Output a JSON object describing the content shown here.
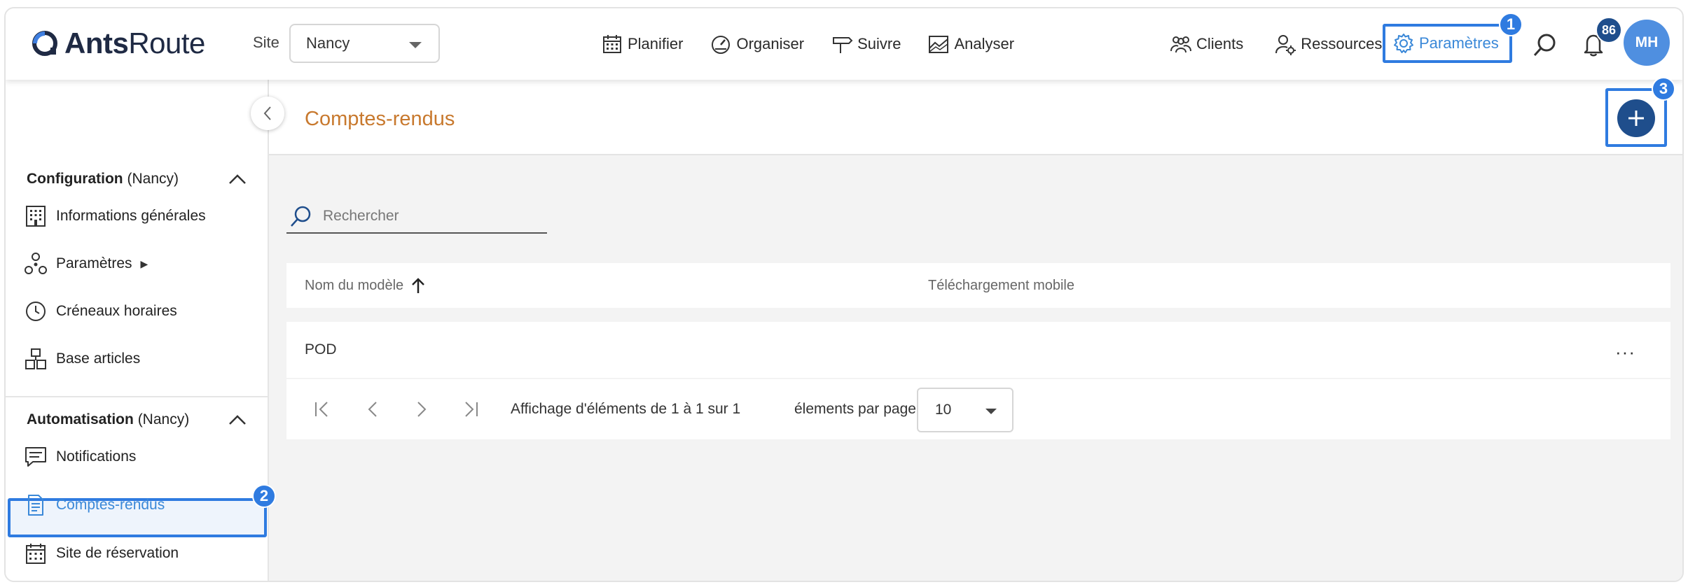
{
  "brand": {
    "name_bold": "Ants",
    "name_rest": "Route",
    "accent": "#1f4e8c"
  },
  "header": {
    "site_label": "Site",
    "site_value": "Nancy",
    "nav": [
      {
        "label": "Planifier",
        "icon": "calendar-icon"
      },
      {
        "label": "Organiser",
        "icon": "gauge-icon"
      },
      {
        "label": "Suivre",
        "icon": "signpost-icon"
      },
      {
        "label": "Analyser",
        "icon": "chart-icon"
      }
    ],
    "right_nav": [
      {
        "label": "Clients",
        "icon": "users-icon"
      },
      {
        "label": "Ressources",
        "icon": "user-gear-icon"
      }
    ],
    "params_label": "Paramètres",
    "notifications_count": "86",
    "avatar_initials": "MH"
  },
  "steps": {
    "one": "1",
    "two": "2",
    "three": "3",
    "color": "#2f7be0"
  },
  "sidebar": {
    "sections": [
      {
        "title": "Configuration",
        "suffix": "(Nancy)"
      },
      {
        "title": "Automatisation",
        "suffix": "(Nancy)"
      }
    ],
    "items": [
      {
        "label": "Informations générales",
        "icon": "building-icon"
      },
      {
        "label": "Paramètres",
        "icon": "nodes-icon",
        "arrow": "▶"
      },
      {
        "label": "Créneaux horaires",
        "icon": "clock-icon"
      },
      {
        "label": "Base articles",
        "icon": "boxes-icon"
      },
      {
        "label": "Notifications",
        "icon": "message-icon"
      },
      {
        "label": "Comptes-rendus",
        "icon": "document-icon",
        "active": true
      },
      {
        "label": "Site de réservation",
        "icon": "calendar-icon"
      }
    ]
  },
  "content": {
    "title": "Comptes-rendus",
    "search_placeholder": "Rechercher",
    "columns": [
      "Nom du modèle",
      "Téléchargement mobile"
    ],
    "rows": [
      {
        "name": "POD",
        "mobile": ""
      }
    ],
    "row_menu": "···",
    "pager": {
      "info": "Affichage d'éléments de 1 à 1 sur 1",
      "per_page_label": "élements par page",
      "per_page_value": "10"
    }
  }
}
